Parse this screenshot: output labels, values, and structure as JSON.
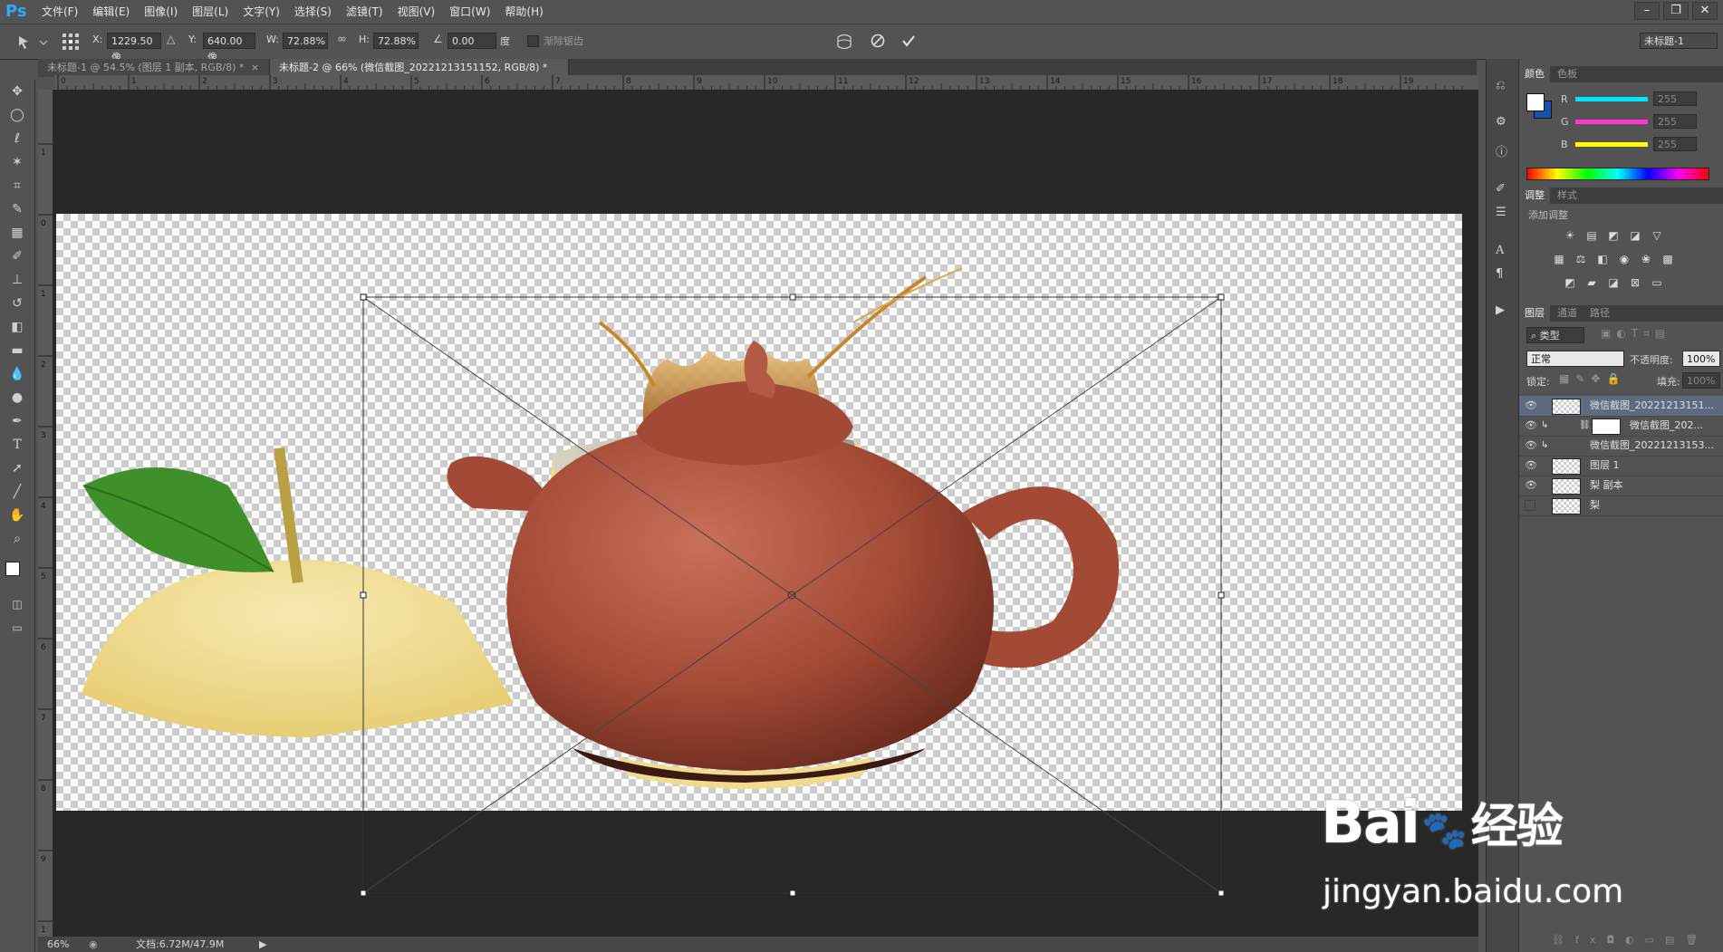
{
  "app": {
    "logo": "Ps",
    "menu": [
      "文件(F)",
      "编辑(E)",
      "图像(I)",
      "图层(L)",
      "文字(Y)",
      "选择(S)",
      "滤镜(T)",
      "视图(V)",
      "窗口(W)",
      "帮助(H)"
    ],
    "window_buttons": [
      "–",
      "❐",
      "✕"
    ]
  },
  "options": {
    "x_label": "X:",
    "x_value": "1229.50 像",
    "y_label": "Y:",
    "y_value": "640.00 像",
    "w_label": "W:",
    "w_value": "72.88%",
    "h_label": "H:",
    "h_value": "72.88%",
    "angle_value": "0.00",
    "angle_unit": "度",
    "interp_label": "渐除锯齿",
    "workspace_label": "未标题-1"
  },
  "tabs": [
    {
      "label": "未标题-1 @ 54.5% (图层 1 副本, RGB/8) *",
      "close": "×"
    },
    {
      "label": "未标题-2 @ 66% (微信截图_20221213151152, RGB/8) *",
      "close": "×"
    }
  ],
  "ruler": {
    "h_ticks": [
      "0",
      "1",
      "2",
      "3",
      "4",
      "5",
      "6",
      "7",
      "8",
      "9",
      "10",
      "11",
      "12",
      "13",
      "14",
      "15",
      "16",
      "17",
      "18",
      "19"
    ],
    "v_ticks": [
      "1",
      "0",
      "1",
      "2",
      "3",
      "4",
      "5",
      "6",
      "7",
      "8",
      "9",
      "1"
    ]
  },
  "status": {
    "zoom": "66%",
    "doc_info": "文档:6.72M/47.9M"
  },
  "color_panel": {
    "tabs": [
      "颜色",
      "色板"
    ],
    "channels": [
      {
        "label": "R",
        "value": "255",
        "color": "#00e5ff"
      },
      {
        "label": "G",
        "value": "255",
        "color": "#ff37d0"
      },
      {
        "label": "B",
        "value": "255",
        "color": "#ffff00"
      }
    ]
  },
  "adjust_panel": {
    "tabs": [
      "调整",
      "样式"
    ],
    "title": "添加调整"
  },
  "layers_panel": {
    "tabs": [
      "图层",
      "通道",
      "路径"
    ],
    "filter_label": "类型",
    "blend_mode": "正常",
    "opacity_label": "不透明度:",
    "opacity_value": "100%",
    "lock_label": "锁定:",
    "fill_label": "填充:",
    "fill_value": "100%",
    "layers": [
      {
        "name": "微信截图_20221213151...",
        "selected": true,
        "visible": true
      },
      {
        "name": "微信截图_202...",
        "selected": false,
        "visible": true
      },
      {
        "name": "微信截图_20221213153...",
        "selected": false,
        "visible": true
      },
      {
        "name": "图层 1",
        "selected": false,
        "visible": true
      },
      {
        "name": "梨 副本",
        "selected": false,
        "visible": true
      },
      {
        "name": "梨",
        "selected": false,
        "visible": false
      }
    ]
  },
  "watermark": {
    "brand": "Bai",
    "brand_suffix": "经验",
    "url": "jingyan.baidu.com"
  },
  "colors": {
    "accent": "#31a8ff",
    "teapot": "#a8503c",
    "pear": "#f0dc8c",
    "leaf": "#3f8f2a",
    "tea": "#c7862a",
    "selection_bg": "#5d6a80"
  }
}
